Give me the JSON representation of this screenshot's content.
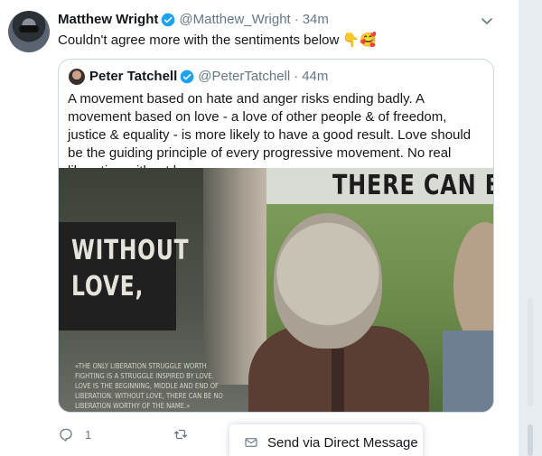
{
  "tweet": {
    "author_name": "Matthew Wright",
    "author_handle": "@Matthew_Wright",
    "separator": "·",
    "time": "34m",
    "text": "Couldn't agree more with the sentiments below",
    "emojis": "👇🥰",
    "reply_count": "1"
  },
  "quoted_tweet": {
    "author_name": "Peter Tatchell",
    "author_handle": "@PeterTatchell",
    "separator": "·",
    "time": "44m",
    "text": "A movement based on hate and anger risks ending badly. A movement based on love - a love of other people & of freedom, justice & equality - is more likely to have a good result. Love should be the guiding principle of every progressive movement. No real liberation without love",
    "media": {
      "headline": "THERE CAN BE N",
      "banner_line1": "WITHOUT",
      "banner_line2": "LOVE,",
      "caption": "«THE ONLY LIBERATION STRUGGLE WORTH FIGHTING IS A STRUGGLE INSPIRED BY LOVE. LOVE IS THE BEGINNING, MIDDLE AND END OF LIBERATION. WITHOUT LOVE, THERE CAN BE NO LIBERATION WORTHY OF THE NAME.»"
    }
  },
  "share_menu": {
    "dm_label": "Send via Direct Message"
  },
  "colors": {
    "verified": "#1da1f2",
    "secondary_text": "#657786",
    "border": "#ccd6dd",
    "gutter": "#e6ecf0"
  },
  "icons": [
    "verified-badge-icon",
    "chevron-down-icon",
    "reply-icon",
    "retweet-icon",
    "envelope-icon"
  ]
}
